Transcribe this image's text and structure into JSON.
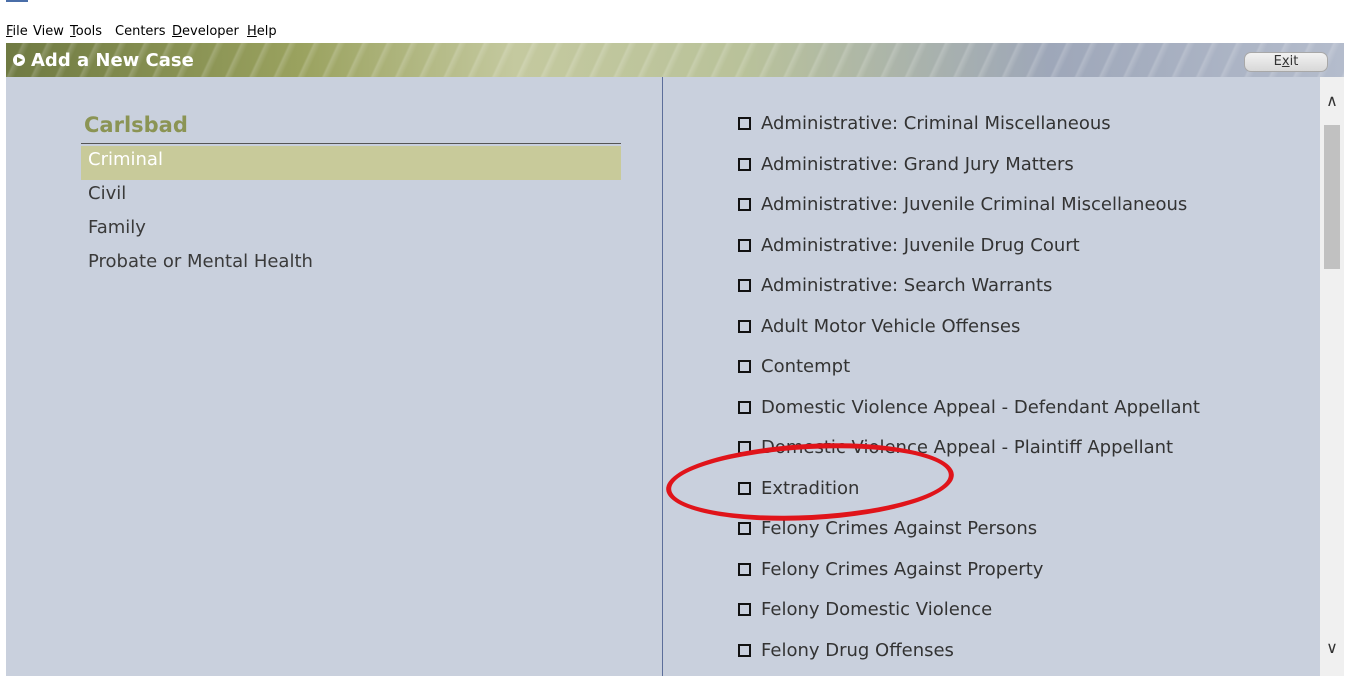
{
  "menu": [
    {
      "name": "menu-file",
      "label": "File"
    },
    {
      "name": "menu-view",
      "label": "View"
    },
    {
      "name": "menu-tools",
      "label": "Tools"
    },
    {
      "name": "menu-centers",
      "label": "Centers"
    },
    {
      "name": "menu-developer",
      "label": "Developer"
    },
    {
      "name": "menu-help",
      "label": "Help"
    }
  ],
  "header": {
    "title": "Add a New Case",
    "exit_label": "Exit"
  },
  "court": {
    "name": "Carlsbad"
  },
  "categories": [
    "Criminal",
    "Civil",
    "Family",
    "Probate or Mental Health"
  ],
  "selected_category": "Criminal",
  "case_types": [
    "Administrative: Criminal Miscellaneous",
    "Administrative: Grand Jury Matters",
    "Administrative: Juvenile Criminal Miscellaneous",
    "Administrative: Juvenile Drug Court",
    "Administrative: Search Warrants",
    "Adult Motor Vehicle Offenses",
    "Contempt",
    "Domestic Violence Appeal - Defendant Appellant",
    "Domestic Violence Appeal - Plaintiff Appellant",
    "Extradition",
    "Felony Crimes Against Persons",
    "Felony Crimes Against Property",
    "Felony Domestic Violence",
    "Felony Drug Offenses"
  ],
  "highlighted_case_type": "Extradition",
  "colors": {
    "annotation": "#e0141a",
    "selected_bg": "#c8ca9a",
    "court_name": "#8b9454",
    "pane_bg": "#c9d0dd"
  },
  "icons": {
    "title": "play-icon",
    "case_checkbox": "checkbox-empty-icon",
    "scroll_up": "chevron-up-icon",
    "scroll_down": "chevron-down-icon"
  }
}
